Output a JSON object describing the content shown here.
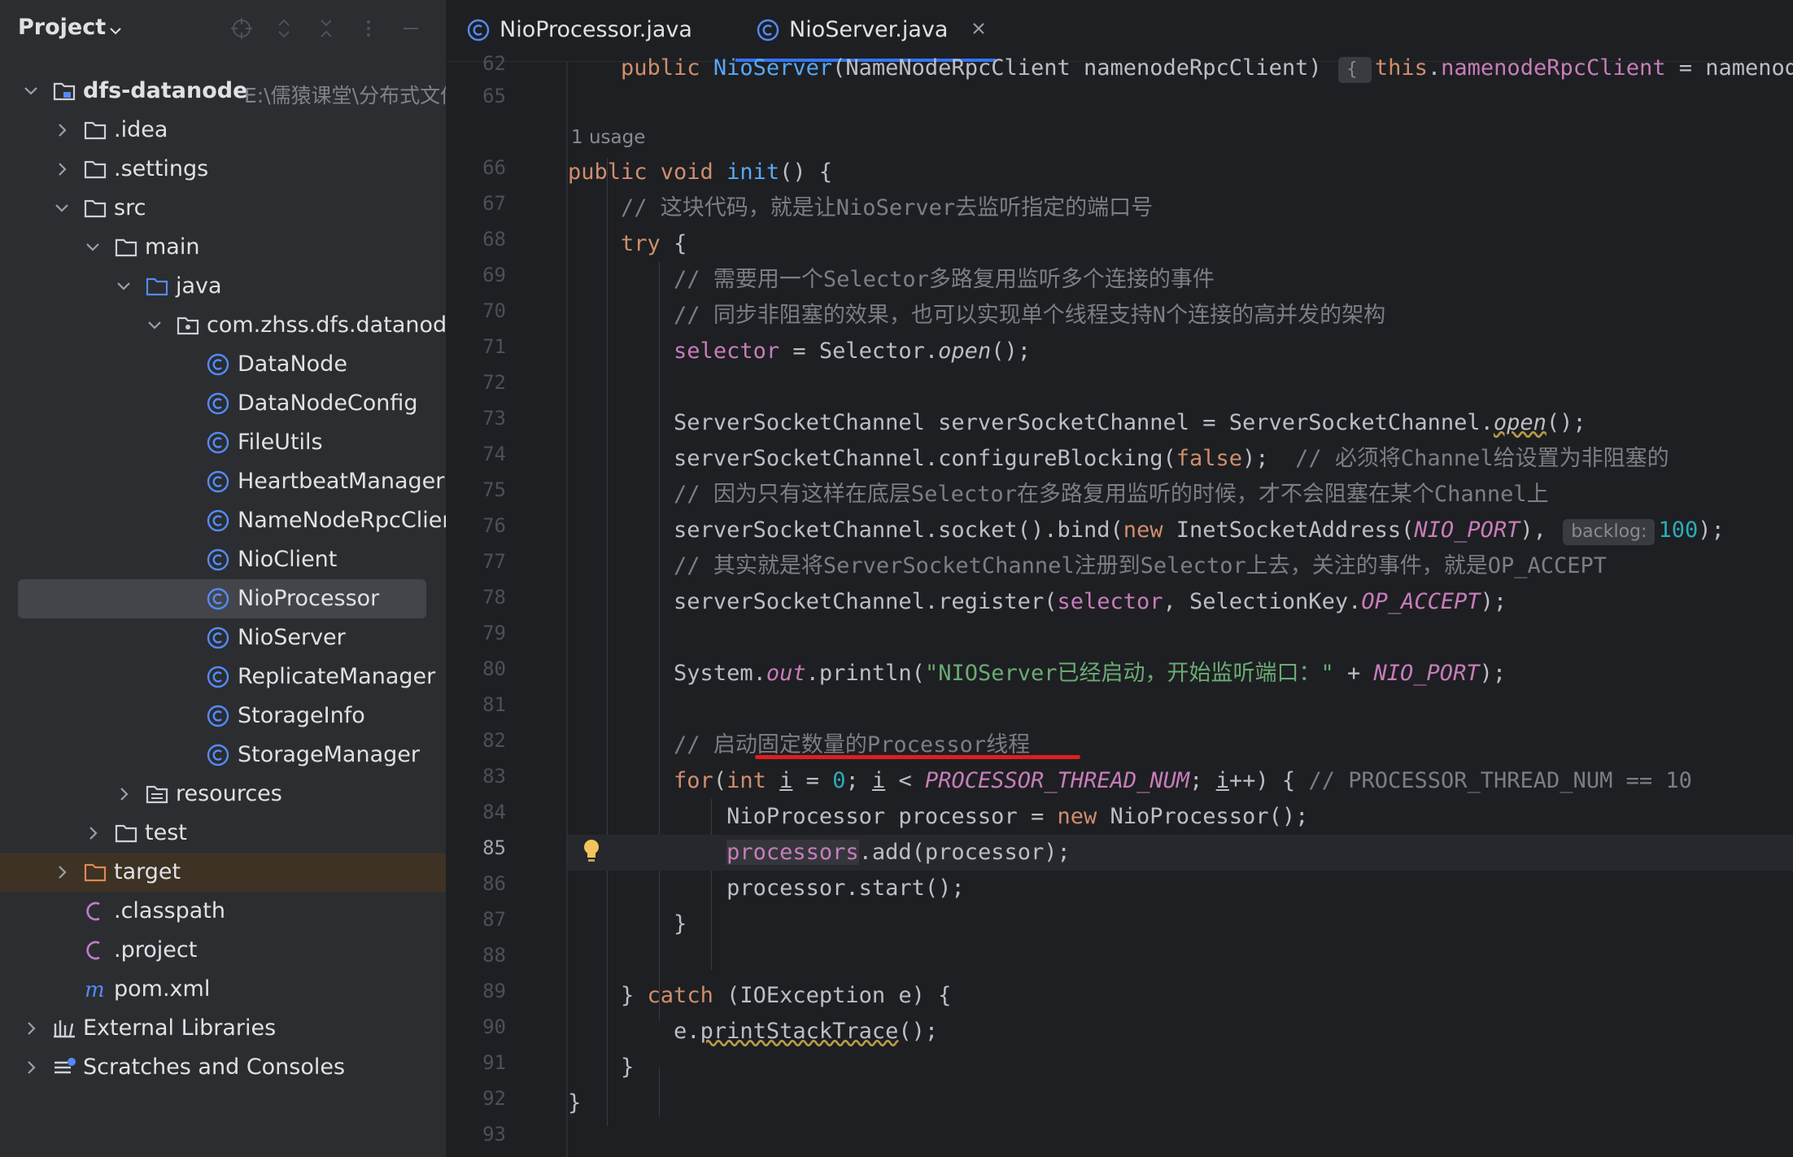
{
  "project_panel": {
    "title": "Project",
    "tree": [
      {
        "label": "dfs-datanode",
        "sub": "E:\\儒猿课堂\\分布式文件",
        "icon": "module-folder-icon"
      },
      {
        "label": ".idea",
        "icon": "folder-icon"
      },
      {
        "label": ".settings",
        "icon": "folder-icon"
      },
      {
        "label": "src",
        "icon": "folder-icon"
      },
      {
        "label": "main",
        "icon": "folder-icon"
      },
      {
        "label": "java",
        "icon": "source-folder-icon"
      },
      {
        "label": "com.zhss.dfs.datanode.",
        "icon": "package-icon"
      },
      {
        "label": "DataNode",
        "icon": "class-icon"
      },
      {
        "label": "DataNodeConfig",
        "icon": "class-icon"
      },
      {
        "label": "FileUtils",
        "icon": "class-icon"
      },
      {
        "label": "HeartbeatManager",
        "icon": "class-icon"
      },
      {
        "label": "NameNodeRpcClient",
        "icon": "class-icon"
      },
      {
        "label": "NioClient",
        "icon": "class-icon"
      },
      {
        "label": "NioProcessor",
        "icon": "class-icon"
      },
      {
        "label": "NioServer",
        "icon": "class-icon"
      },
      {
        "label": "ReplicateManager",
        "icon": "class-icon"
      },
      {
        "label": "StorageInfo",
        "icon": "class-icon"
      },
      {
        "label": "StorageManager",
        "icon": "class-icon"
      },
      {
        "label": "resources",
        "icon": "resources-folder-icon"
      },
      {
        "label": "test",
        "icon": "folder-icon"
      },
      {
        "label": "target",
        "icon": "excluded-folder-icon"
      },
      {
        "label": ".classpath",
        "icon": "eclipse-file-icon"
      },
      {
        "label": ".project",
        "icon": "eclipse-file-icon"
      },
      {
        "label": "pom.xml",
        "icon": "maven-icon"
      },
      {
        "label": "External Libraries",
        "icon": "libraries-icon"
      },
      {
        "label": "Scratches and Consoles",
        "icon": "scratches-icon"
      }
    ]
  },
  "tabs": [
    {
      "label": "NioProcessor.java",
      "active": false
    },
    {
      "label": "NioServer.java",
      "active": true
    }
  ],
  "editor": {
    "current_line": "85",
    "usage_hint": "1 usage",
    "backlog_hint": "backlog:",
    "line_numbers": [
      "62",
      "65",
      "",
      "66",
      "67",
      "68",
      "69",
      "70",
      "71",
      "72",
      "73",
      "74",
      "75",
      "76",
      "77",
      "78",
      "79",
      "80",
      "81",
      "82",
      "83",
      "84",
      "85",
      "86",
      "87",
      "88",
      "89",
      "90",
      "91",
      "92",
      "93"
    ],
    "code": {
      "l62": {
        "a": "public ",
        "b": "NioServer",
        "c": "(NameNodeRpcClient namenodeRpcClient) ",
        "d": "{ ",
        "e": "this",
        "f": ".",
        "g": "namenodeRpcClient",
        "h": " = namenodeR"
      },
      "l66": {
        "a": "public void ",
        "b": "init",
        "c": "() {"
      },
      "l67": "// 这块代码，就是让NioServer去监听指定的端口号",
      "l68": {
        "a": "try",
        "b": " {"
      },
      "l69": "// 需要用一个Selector多路复用监听多个连接的事件",
      "l70": "// 同步非阻塞的效果，也可以实现单个线程支持N个连接的高并发的架构",
      "l71": {
        "a": "selector",
        "b": " = Selector.",
        "c": "open",
        "d": "();"
      },
      "l73": {
        "a": "ServerSocketChannel serverSocketChannel = ServerSocketChannel.",
        "b": "open",
        "c": "();"
      },
      "l74": {
        "a": "serverSocketChannel.configureBlocking(",
        "b": "false",
        "c": ");  ",
        "d": "// 必须将Channel给设置为非阻塞的"
      },
      "l75": "// 因为只有这样在底层Selector在多路复用监听的时候，才不会阻塞在某个Channel上",
      "l76": {
        "a": "serverSocketChannel.socket().bind(",
        "b": "new",
        "c": " InetSocketAddress(",
        "d": "NIO_PORT",
        "e": "), ",
        "f": "100",
        "g": ");"
      },
      "l77": "// 其实就是将ServerSocketChannel注册到Selector上去，关注的事件，就是OP_ACCEPT",
      "l78": {
        "a": "serverSocketChannel.register(",
        "b": "selector",
        "c": ", SelectionKey.",
        "d": "OP_ACCEPT",
        "e": ");"
      },
      "l80": {
        "a": "System.",
        "b": "out",
        "c": ".println(",
        "d": "\"NIOServer已经启动，开始监听端口：\"",
        "e": " + ",
        "f": "NIO_PORT",
        "g": ");"
      },
      "l82": "// 启动固定数量的Processor线程",
      "l83": {
        "a": "for",
        "b": "(",
        "c": "int",
        "d": " ",
        "e": "i",
        "f": " = ",
        "g": "0",
        "h": "; ",
        "i": "i",
        "j": " < ",
        "k": "PROCESSOR_THREAD_NUM",
        "l": "; ",
        "m": "i",
        "n": "++) { ",
        "o": "// PROCESSOR_THREAD_NUM == 10"
      },
      "l84": {
        "a": "NioProcessor processor = ",
        "b": "new",
        "c": " NioProcessor();"
      },
      "l85": {
        "a": "processors",
        "b": ".add(processor);"
      },
      "l86": "processor.start();",
      "l87": "}",
      "l89": {
        "a": "} ",
        "b": "catch",
        "c": " (IOException e) {"
      },
      "l90": {
        "a": "e.",
        "b": "printStackTrace",
        "c": "();"
      },
      "l91": "}",
      "l92": "}"
    }
  },
  "colors": {
    "keyword": "#cf8e6d",
    "field": "#c77dbb",
    "method_decl": "#56a8f5",
    "string": "#6aab73",
    "number": "#2aacb8",
    "comment": "#7a7e85",
    "annotation_underline": "#e01e1e",
    "selected_row": "#43454a",
    "excluded_row": "#3d3223",
    "accent": "#3574f0"
  }
}
